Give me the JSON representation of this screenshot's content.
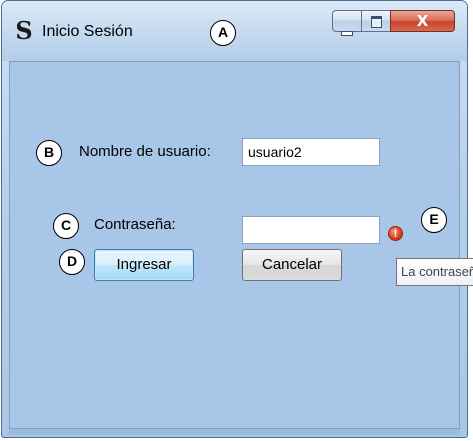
{
  "window": {
    "title": "Inicio Sesión",
    "app_icon_glyph": "S",
    "controls": {
      "close_glyph": "X"
    }
  },
  "form": {
    "username_label": "Nombre de usuario:",
    "username_value": "usuario2",
    "password_label": "Contraseña:",
    "password_value": "",
    "error_icon": "error-icon",
    "error_icon_glyph": "!",
    "tooltip_text": "La contraseña",
    "login_button": "Ingresar",
    "cancel_button": "Cancelar"
  },
  "callouts": {
    "a": "A",
    "b": "B",
    "c": "C",
    "d": "D",
    "e": "E"
  },
  "colors": {
    "client_background": "#a8c6e7",
    "close_button": "#c6452b",
    "error_icon": "#e0401d"
  }
}
